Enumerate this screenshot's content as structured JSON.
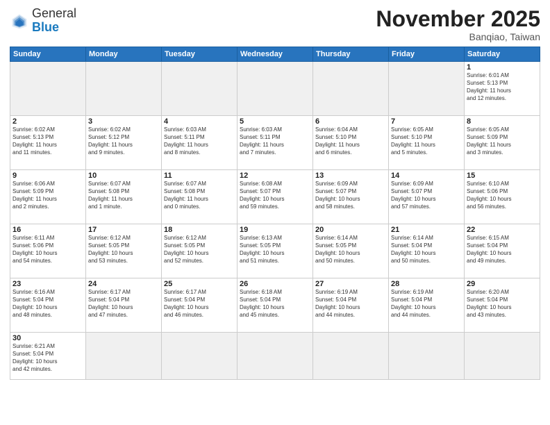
{
  "header": {
    "logo_general": "General",
    "logo_blue": "Blue",
    "month_title": "November 2025",
    "location": "Banqiao, Taiwan"
  },
  "weekdays": [
    "Sunday",
    "Monday",
    "Tuesday",
    "Wednesday",
    "Thursday",
    "Friday",
    "Saturday"
  ],
  "weeks": [
    [
      {
        "day": "",
        "info": ""
      },
      {
        "day": "",
        "info": ""
      },
      {
        "day": "",
        "info": ""
      },
      {
        "day": "",
        "info": ""
      },
      {
        "day": "",
        "info": ""
      },
      {
        "day": "",
        "info": ""
      },
      {
        "day": "1",
        "info": "Sunrise: 6:01 AM\nSunset: 5:13 PM\nDaylight: 11 hours\nand 12 minutes."
      }
    ],
    [
      {
        "day": "2",
        "info": "Sunrise: 6:02 AM\nSunset: 5:13 PM\nDaylight: 11 hours\nand 11 minutes."
      },
      {
        "day": "3",
        "info": "Sunrise: 6:02 AM\nSunset: 5:12 PM\nDaylight: 11 hours\nand 9 minutes."
      },
      {
        "day": "4",
        "info": "Sunrise: 6:03 AM\nSunset: 5:11 PM\nDaylight: 11 hours\nand 8 minutes."
      },
      {
        "day": "5",
        "info": "Sunrise: 6:03 AM\nSunset: 5:11 PM\nDaylight: 11 hours\nand 7 minutes."
      },
      {
        "day": "6",
        "info": "Sunrise: 6:04 AM\nSunset: 5:10 PM\nDaylight: 11 hours\nand 6 minutes."
      },
      {
        "day": "7",
        "info": "Sunrise: 6:05 AM\nSunset: 5:10 PM\nDaylight: 11 hours\nand 5 minutes."
      },
      {
        "day": "8",
        "info": "Sunrise: 6:05 AM\nSunset: 5:09 PM\nDaylight: 11 hours\nand 3 minutes."
      }
    ],
    [
      {
        "day": "9",
        "info": "Sunrise: 6:06 AM\nSunset: 5:09 PM\nDaylight: 11 hours\nand 2 minutes."
      },
      {
        "day": "10",
        "info": "Sunrise: 6:07 AM\nSunset: 5:08 PM\nDaylight: 11 hours\nand 1 minute."
      },
      {
        "day": "11",
        "info": "Sunrise: 6:07 AM\nSunset: 5:08 PM\nDaylight: 11 hours\nand 0 minutes."
      },
      {
        "day": "12",
        "info": "Sunrise: 6:08 AM\nSunset: 5:07 PM\nDaylight: 10 hours\nand 59 minutes."
      },
      {
        "day": "13",
        "info": "Sunrise: 6:09 AM\nSunset: 5:07 PM\nDaylight: 10 hours\nand 58 minutes."
      },
      {
        "day": "14",
        "info": "Sunrise: 6:09 AM\nSunset: 5:07 PM\nDaylight: 10 hours\nand 57 minutes."
      },
      {
        "day": "15",
        "info": "Sunrise: 6:10 AM\nSunset: 5:06 PM\nDaylight: 10 hours\nand 56 minutes."
      }
    ],
    [
      {
        "day": "16",
        "info": "Sunrise: 6:11 AM\nSunset: 5:06 PM\nDaylight: 10 hours\nand 54 minutes."
      },
      {
        "day": "17",
        "info": "Sunrise: 6:12 AM\nSunset: 5:05 PM\nDaylight: 10 hours\nand 53 minutes."
      },
      {
        "day": "18",
        "info": "Sunrise: 6:12 AM\nSunset: 5:05 PM\nDaylight: 10 hours\nand 52 minutes."
      },
      {
        "day": "19",
        "info": "Sunrise: 6:13 AM\nSunset: 5:05 PM\nDaylight: 10 hours\nand 51 minutes."
      },
      {
        "day": "20",
        "info": "Sunrise: 6:14 AM\nSunset: 5:05 PM\nDaylight: 10 hours\nand 50 minutes."
      },
      {
        "day": "21",
        "info": "Sunrise: 6:14 AM\nSunset: 5:04 PM\nDaylight: 10 hours\nand 50 minutes."
      },
      {
        "day": "22",
        "info": "Sunrise: 6:15 AM\nSunset: 5:04 PM\nDaylight: 10 hours\nand 49 minutes."
      }
    ],
    [
      {
        "day": "23",
        "info": "Sunrise: 6:16 AM\nSunset: 5:04 PM\nDaylight: 10 hours\nand 48 minutes."
      },
      {
        "day": "24",
        "info": "Sunrise: 6:17 AM\nSunset: 5:04 PM\nDaylight: 10 hours\nand 47 minutes."
      },
      {
        "day": "25",
        "info": "Sunrise: 6:17 AM\nSunset: 5:04 PM\nDaylight: 10 hours\nand 46 minutes."
      },
      {
        "day": "26",
        "info": "Sunrise: 6:18 AM\nSunset: 5:04 PM\nDaylight: 10 hours\nand 45 minutes."
      },
      {
        "day": "27",
        "info": "Sunrise: 6:19 AM\nSunset: 5:04 PM\nDaylight: 10 hours\nand 44 minutes."
      },
      {
        "day": "28",
        "info": "Sunrise: 6:19 AM\nSunset: 5:04 PM\nDaylight: 10 hours\nand 44 minutes."
      },
      {
        "day": "29",
        "info": "Sunrise: 6:20 AM\nSunset: 5:04 PM\nDaylight: 10 hours\nand 43 minutes."
      }
    ],
    [
      {
        "day": "30",
        "info": "Sunrise: 6:21 AM\nSunset: 5:04 PM\nDaylight: 10 hours\nand 42 minutes."
      },
      {
        "day": "",
        "info": ""
      },
      {
        "day": "",
        "info": ""
      },
      {
        "day": "",
        "info": ""
      },
      {
        "day": "",
        "info": ""
      },
      {
        "day": "",
        "info": ""
      },
      {
        "day": "",
        "info": ""
      }
    ]
  ]
}
